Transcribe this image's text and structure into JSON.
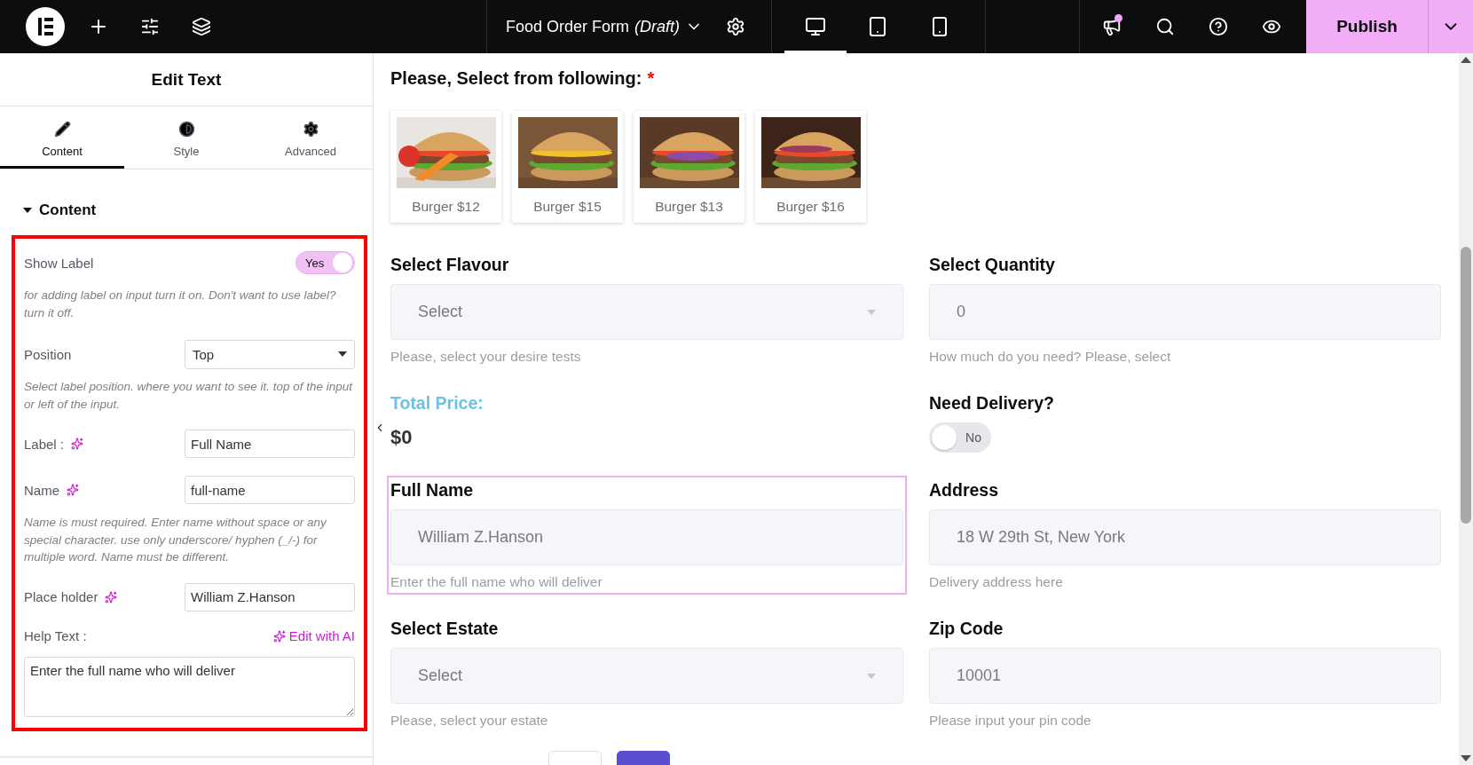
{
  "topbar": {
    "page_title": "Food Order Form",
    "page_status": "(Draft)",
    "devices": [
      {
        "kind": "desktop",
        "selected": true
      },
      {
        "kind": "tablet",
        "selected": false
      },
      {
        "kind": "mobile",
        "selected": false
      }
    ],
    "publish": "Publish"
  },
  "panel": {
    "title": "Edit Text",
    "tabs": [
      {
        "kind": "content",
        "label": "Content",
        "selected": true
      },
      {
        "kind": "style",
        "label": "Style",
        "selected": false
      },
      {
        "kind": "advanced",
        "label": "Advanced",
        "selected": false
      }
    ],
    "section": "Content",
    "controls": [
      {
        "kind": "switch",
        "label": "Show Label",
        "value": "Yes",
        "on": true
      },
      {
        "kind": "note",
        "text": "for adding label on input turn it on. Don't want to use label? turn it off."
      },
      {
        "kind": "dropdown",
        "label": "Position",
        "value": "Top"
      },
      {
        "kind": "note",
        "text": "Select label position. where you want to see it. top of the input or left of the input."
      },
      {
        "kind": "text",
        "label": "Label :",
        "value": "Full Name",
        "ai": true
      },
      {
        "kind": "text",
        "label": "Name",
        "value": "full-name",
        "ai": true
      },
      {
        "kind": "note",
        "text": "Name is must required. Enter name without space or any special character. use only underscore/ hyphen (_/-) for multiple word. Name must be different."
      },
      {
        "kind": "text",
        "label": "Place holder",
        "value": "William Z.Hanson",
        "ai": true
      },
      {
        "kind": "textarea",
        "label": "Help Text :",
        "link": "Edit with AI",
        "value": "Enter the full name who will deliver"
      }
    ]
  },
  "form": {
    "heading": "Please, Select from following:",
    "required": "*",
    "products": [
      {
        "name": "Burger $12"
      },
      {
        "name": "Burger $15"
      },
      {
        "name": "Burger $13"
      },
      {
        "name": "Burger $16"
      }
    ],
    "fields": [
      {
        "kind": "select",
        "label": "Select Flavour",
        "placeholder": "Select",
        "help": "Please, select your desire tests",
        "selected": false
      },
      {
        "kind": "input",
        "label": "Select Quantity",
        "placeholder": "0",
        "help": "How much do you need? Please, select",
        "selected": false
      },
      {
        "kind": "price",
        "label": "Total Price:",
        "value": "$0",
        "selected": false
      },
      {
        "kind": "toggle",
        "label": "Need Delivery?",
        "text": "No",
        "on": false,
        "selected": false
      },
      {
        "kind": "input",
        "label": "Full Name",
        "placeholder": "William Z.Hanson",
        "help": "Enter the full name who will deliver",
        "selected": true
      },
      {
        "kind": "input",
        "label": "Address",
        "placeholder": "18 W 29th St, New York",
        "help": "Delivery address here",
        "selected": false
      },
      {
        "kind": "select",
        "label": "Select Estate",
        "placeholder": "Select",
        "help": "Please, select your estate",
        "selected": false
      },
      {
        "kind": "input",
        "label": "Zip Code",
        "placeholder": "10001",
        "help": "Please input your pin code",
        "selected": false
      }
    ]
  }
}
